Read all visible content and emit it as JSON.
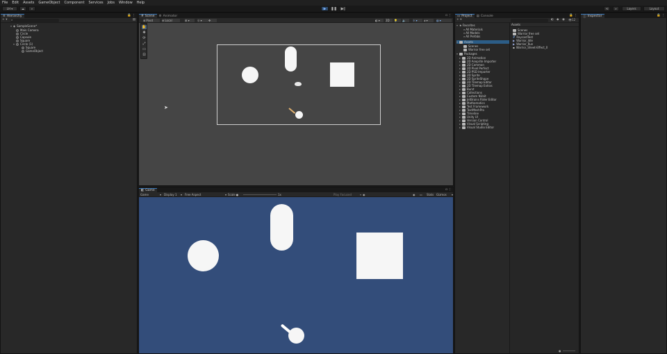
{
  "menu": [
    "File",
    "Edit",
    "Assets",
    "GameObject",
    "Component",
    "Services",
    "Jobs",
    "Window",
    "Help"
  ],
  "toolbar": {
    "account_label": "LH ▾",
    "cloud_icon": "cloud-icon",
    "collab_icon": "search-icon",
    "layers_label": "Layers",
    "layout_label": "Layout"
  },
  "hierarchy": {
    "tab_label": "Hierarchy",
    "scene_name": "SampleScene*",
    "items": [
      "Main Camera",
      "Circle",
      "Capsule",
      "Square",
      "Circle (1)",
      "Square",
      "GameObject"
    ]
  },
  "scene": {
    "tabs": [
      "Scene",
      "Animator"
    ],
    "pivot_label": "Pivot",
    "local_label": "Local",
    "mode_label": "2D"
  },
  "game": {
    "tab_label": "Game",
    "game_dd": "Game",
    "display_dd": "Display 1",
    "aspect_dd": "Free Aspect",
    "scale_label": "Scale",
    "scale_value": "1x",
    "play_focused": "Play Focused",
    "stats_label": "Stats",
    "gizmos_label": "Gizmos"
  },
  "project": {
    "tabs": [
      "Project",
      "Console"
    ],
    "count_badge": "12",
    "favorites_label": "Favorites",
    "favorites": [
      "All Materials",
      "All Models",
      "All Prefabs"
    ],
    "assets_label": "Assets",
    "assets_children": [
      "Scenes",
      "Warrior free set"
    ],
    "packages_label": "Packages",
    "packages": [
      "2D Animation",
      "2D Aseprite Importer",
      "2D Common",
      "2D Pixel Perfect",
      "2D PSD Importer",
      "2D Sprite",
      "2D SpriteShape",
      "2D Tilemap Editor",
      "2D Tilemap Extras",
      "Burst",
      "Collections",
      "Custom NUnit",
      "JetBrains Rider Editor",
      "Mathematics",
      "Test Framework",
      "TextMeshPro",
      "Timeline",
      "Unity UI",
      "Version Control",
      "Visual Scripting",
      "Visual Studio Editor"
    ],
    "right_header": "Assets",
    "right_items": [
      {
        "label": "Scenes",
        "icon": "folder"
      },
      {
        "label": "Warrior free set",
        "icon": "folder"
      },
      {
        "label": "RaycastTest",
        "icon": "script"
      },
      {
        "label": "Warrior_Idle",
        "icon": "anim"
      },
      {
        "label": "Warrior_Run",
        "icon": "anim"
      },
      {
        "label": "Warrior_Sheet-Effect_0",
        "icon": "sprite"
      }
    ]
  },
  "inspector": {
    "tab_label": "Inspector"
  },
  "colors": {
    "scene_bg": "#454545",
    "game_bg": "#334d7a",
    "accent": "#3a79bb"
  }
}
